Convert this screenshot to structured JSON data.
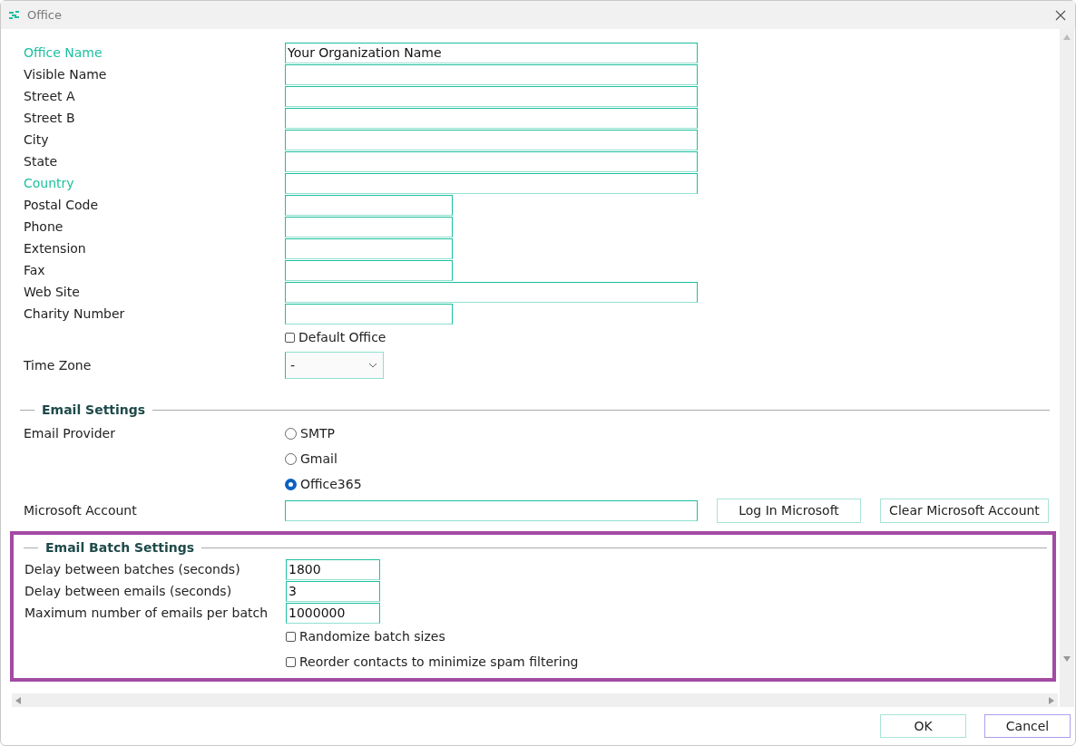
{
  "window": {
    "title": "Office"
  },
  "fields": [
    {
      "label": "Office Name",
      "value": "Your Organization Name",
      "required": true,
      "kind": "long"
    },
    {
      "label": "Visible Name",
      "required": false,
      "kind": "long"
    },
    {
      "label": "Street A",
      "required": false,
      "kind": "long"
    },
    {
      "label": "Street B",
      "required": false,
      "kind": "long"
    },
    {
      "label": "City",
      "required": false,
      "kind": "long"
    },
    {
      "label": "State",
      "required": false,
      "kind": "long"
    },
    {
      "label": "Country",
      "required": true,
      "kind": "long"
    },
    {
      "label": "Postal Code",
      "required": false,
      "kind": "short"
    },
    {
      "label": "Phone",
      "required": false,
      "kind": "short"
    },
    {
      "label": "Extension",
      "required": false,
      "kind": "short"
    },
    {
      "label": "Fax",
      "required": false,
      "kind": "short"
    },
    {
      "label": "Web Site",
      "required": false,
      "kind": "long"
    },
    {
      "label": "Charity Number",
      "required": false,
      "kind": "short"
    }
  ],
  "default_office": {
    "label": "Default Office",
    "checked": false
  },
  "time_zone": {
    "label": "Time Zone",
    "value": "-"
  },
  "email_settings": {
    "title": "Email Settings",
    "provider_label": "Email Provider",
    "providers": [
      {
        "label": "SMTP",
        "selected": false
      },
      {
        "label": "Gmail",
        "selected": false
      },
      {
        "label": "Office365",
        "selected": true
      }
    ],
    "account_label": "Microsoft Account",
    "buttons": [
      "Log In Microsoft",
      "Clear Microsoft Account"
    ]
  },
  "batch_settings": {
    "title": "Email Batch Settings",
    "fields": [
      {
        "label": "Delay between batches (seconds)",
        "value": "1800"
      },
      {
        "label": "Delay between emails (seconds)",
        "value": "3"
      },
      {
        "label": "Maximum number of emails per batch",
        "value": "1000000"
      }
    ],
    "checkboxes": [
      {
        "label": "Randomize batch sizes",
        "checked": false
      },
      {
        "label": "Reorder contacts to minimize spam filtering",
        "checked": false
      }
    ]
  },
  "buttons": [
    {
      "label": "OK",
      "focused": false
    },
    {
      "label": "Cancel",
      "focused": true
    }
  ]
}
